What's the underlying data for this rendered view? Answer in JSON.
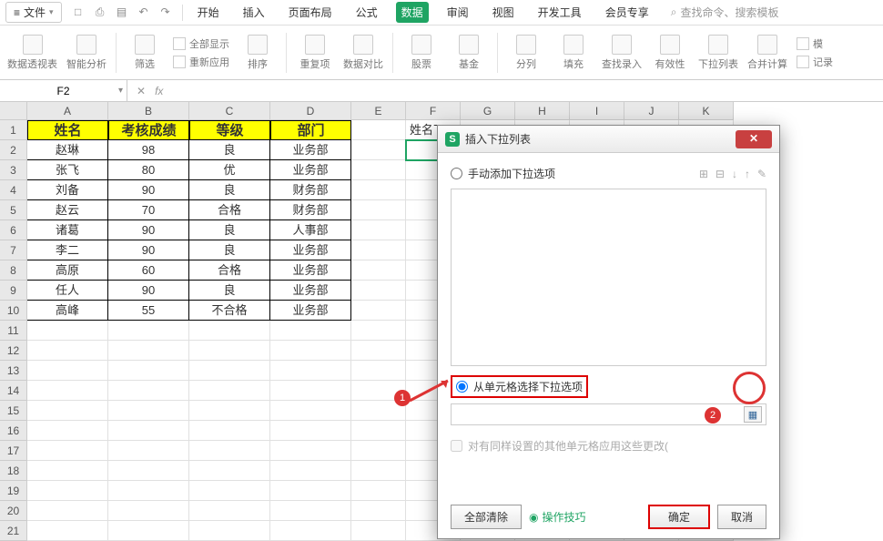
{
  "menu": {
    "file_label": "文件",
    "tabs": [
      "开始",
      "插入",
      "页面布局",
      "公式",
      "数据",
      "审阅",
      "视图",
      "开发工具",
      "会员专享"
    ],
    "active_tab": "数据",
    "search_placeholder": "查找命令、搜索模板"
  },
  "ribbon": {
    "items": [
      "数据透视表",
      "智能分析",
      "筛选",
      "全部显示",
      "重新应用",
      "排序",
      "重复项",
      "数据对比",
      "股票",
      "基金",
      "分列",
      "填充",
      "查找录入",
      "有效性",
      "下拉列表",
      "合并计算",
      "模",
      "记录"
    ]
  },
  "namebox": {
    "value": "F2",
    "fx": "fx"
  },
  "columns": [
    "A",
    "B",
    "C",
    "D",
    "E",
    "F",
    "G",
    "H",
    "I",
    "J",
    "K"
  ],
  "table": {
    "headers": [
      "姓名",
      "考核成绩",
      "等级",
      "部门"
    ],
    "rows": [
      [
        "赵琳",
        "98",
        "良",
        "业务部"
      ],
      [
        "张飞",
        "80",
        "优",
        "业务部"
      ],
      [
        "刘备",
        "90",
        "良",
        "财务部"
      ],
      [
        "赵云",
        "70",
        "合格",
        "财务部"
      ],
      [
        "诸葛",
        "90",
        "良",
        "人事部"
      ],
      [
        "李二",
        "90",
        "良",
        "业务部"
      ],
      [
        "高原",
        "60",
        "合格",
        "业务部"
      ],
      [
        "任人",
        "90",
        "良",
        "业务部"
      ],
      [
        "高峰",
        "55",
        "不合格",
        "业务部"
      ]
    ],
    "f1_label": "姓名下"
  },
  "dialog": {
    "title": "插入下拉列表",
    "opt_manual": "手动添加下拉选项",
    "opt_cell": "从单元格选择下拉选项",
    "chk_apply": "对有同样设置的其他单元格应用这些更改(",
    "btn_clear": "全部清除",
    "link_tips": "操作技巧",
    "btn_ok": "确定",
    "btn_cancel": "取消"
  },
  "anno": {
    "n1": "1",
    "n2": "2"
  }
}
